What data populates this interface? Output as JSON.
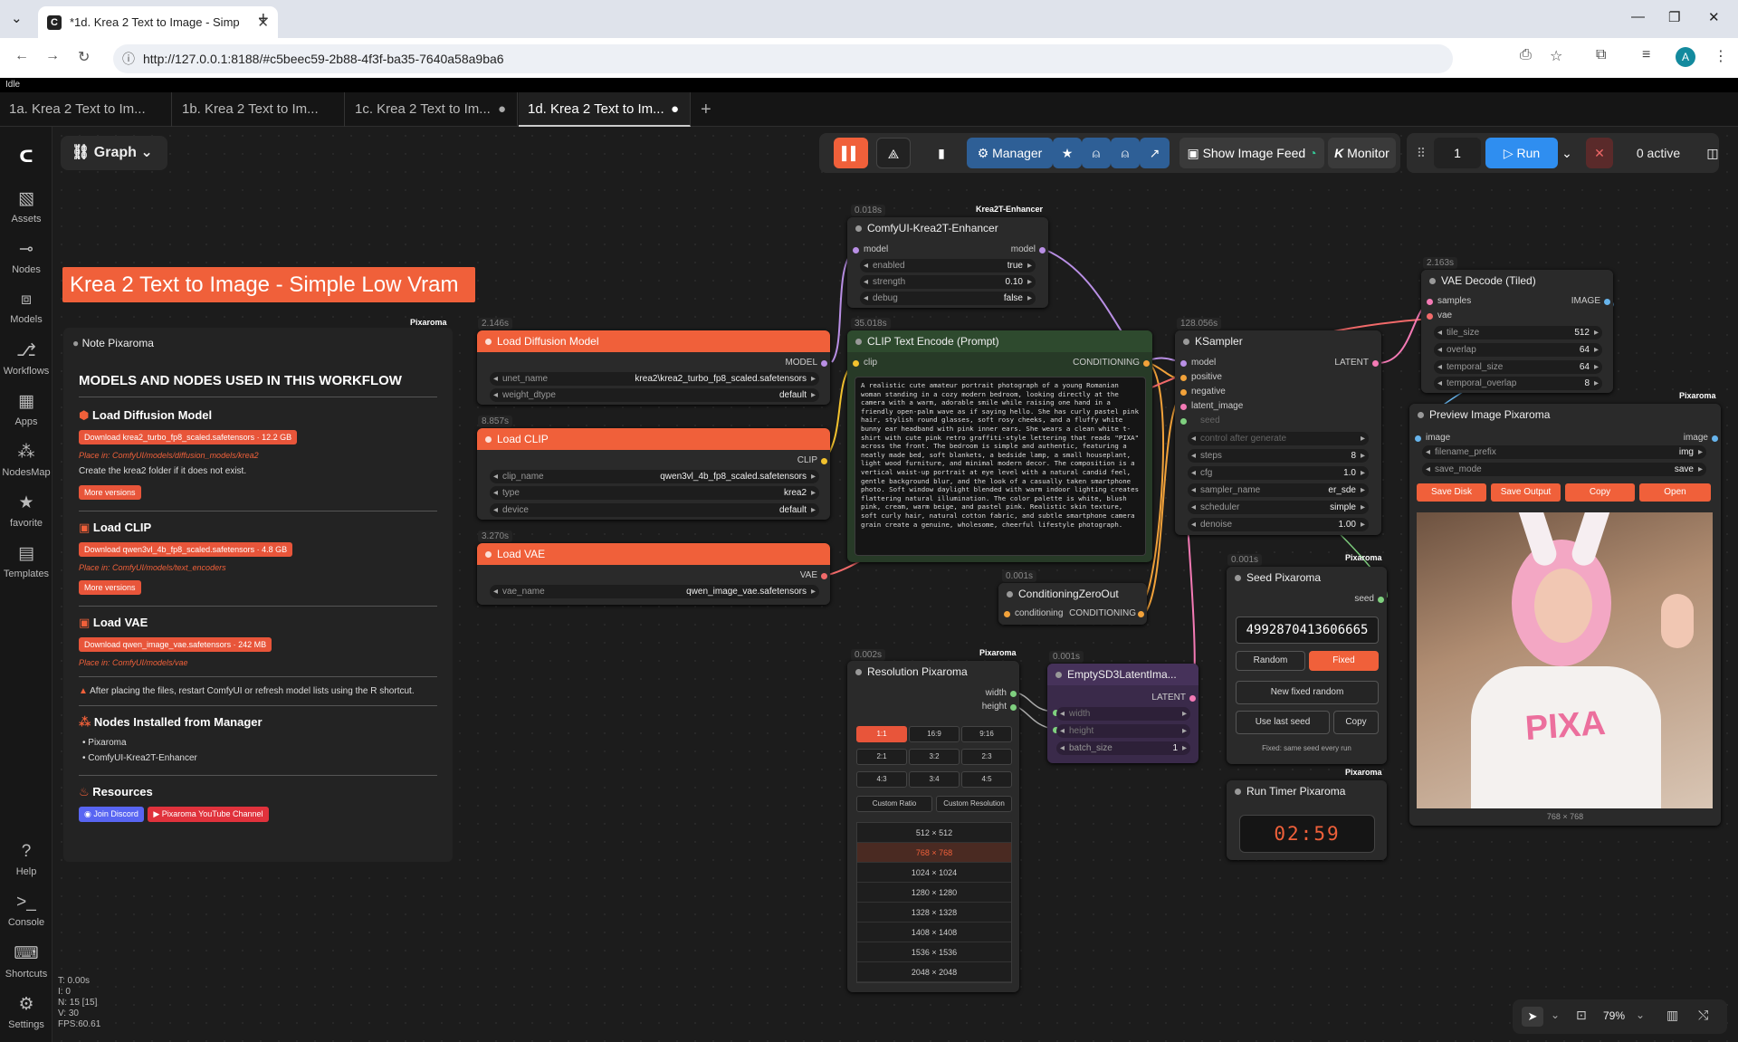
{
  "browser": {
    "tab_title": "*1d. Krea 2 Text to Image - Simp",
    "url": "http://127.0.0.1:8188/#c5beec59-2b88-4f3f-ba35-7640a58a9ba6",
    "avatar": "A"
  },
  "status": "Idle",
  "workflow_tabs": [
    {
      "label": "1a. Krea 2 Text to Im..."
    },
    {
      "label": "1b. Krea 2 Text to Im..."
    },
    {
      "label": "1c. Krea 2 Text to Im..."
    },
    {
      "label": "1d. Krea 2 Text to Im..."
    }
  ],
  "sidebar": {
    "items": [
      {
        "label": "Assets",
        "icon": "image-icon"
      },
      {
        "label": "Nodes",
        "icon": "plug-icon"
      },
      {
        "label": "Models",
        "icon": "cube-icon"
      },
      {
        "label": "Workflows",
        "icon": "flow-icon"
      },
      {
        "label": "Apps",
        "icon": "grid-icon"
      },
      {
        "label": "NodesMap",
        "icon": "map-icon"
      },
      {
        "label": "favorite",
        "icon": "star-icon"
      },
      {
        "label": "Templates",
        "icon": "template-icon"
      },
      {
        "label": "Help",
        "icon": "help-icon"
      },
      {
        "label": "Console",
        "icon": "terminal-icon"
      },
      {
        "label": "Shortcuts",
        "icon": "keyboard-icon"
      },
      {
        "label": "Settings",
        "icon": "gear-icon"
      }
    ]
  },
  "toolbar": {
    "graph": "Graph",
    "manager": "Manager",
    "show_feed": "Show Image Feed",
    "monitor": "Monitor",
    "queue_count": "1",
    "run": "Run",
    "active": "0 active"
  },
  "title_banner": "Krea 2 Text to Image - Simple Low Vram",
  "note": {
    "brand": "Pixaroma",
    "title": "Note Pixaroma",
    "heading": "MODELS AND NODES USED IN THIS WORKFLOW",
    "s1_title": "Load Diffusion Model",
    "s1_dl": "Download krea2_turbo_fp8_scaled.safetensors · 12.2 GB",
    "s1_place": "Place in: ComfyUI/models/diffusion_models/krea2",
    "s1_note": "Create the  krea2  folder if it does not exist.",
    "more": "More versions",
    "s2_title": "Load CLIP",
    "s2_dl": "Download qwen3vl_4b_fp8_scaled.safetensors · 4.8 GB",
    "s2_place": "Place in: ComfyUI/models/text_encoders",
    "s3_title": "Load VAE",
    "s3_dl": "Download qwen_image_vae.safetensors · 242 MB",
    "s3_place": "Place in: ComfyUI/models/vae",
    "warning": "After placing the files, restart ComfyUI or refresh model lists using the R shortcut.",
    "s4_title": "Nodes Installed from Manager",
    "s4_items": [
      "Pixaroma",
      "ComfyUI-Krea2T-Enhancer"
    ],
    "s5_title": "Resources",
    "discord": "Join Discord",
    "youtube": "Pixaroma YouTube Channel"
  },
  "nodes": {
    "load_diffusion": {
      "time": "2.146s",
      "title": "Load Diffusion Model",
      "out": "MODEL",
      "unet_name_l": "unet_name",
      "unet_name": "krea2\\krea2_turbo_fp8_scaled.safetensors",
      "weight_l": "weight_dtype",
      "weight": "default"
    },
    "load_clip": {
      "time": "8.857s",
      "title": "Load CLIP",
      "out": "CLIP",
      "clip_name_l": "clip_name",
      "clip_name": "qwen3vl_4b_fp8_scaled.safetensors",
      "type_l": "type",
      "type": "krea2",
      "device_l": "device",
      "device": "default"
    },
    "load_vae": {
      "time": "3.270s",
      "title": "Load VAE",
      "out": "VAE",
      "vae_name_l": "vae_name",
      "vae_name": "qwen_image_vae.safetensors"
    },
    "enhancer": {
      "time": "0.018s",
      "brand": "Krea2T-Enhancer",
      "title": "ComfyUI-Krea2T-Enhancer",
      "in": "model",
      "out": "model",
      "enabled_l": "enabled",
      "enabled": "true",
      "strength_l": "strength",
      "strength": "0.10",
      "debug_l": "debug",
      "debug": "false"
    },
    "clip_encode": {
      "time": "35.018s",
      "title": "CLIP Text Encode (Prompt)",
      "in": "clip",
      "out": "CONDITIONING",
      "prompt": "A realistic cute amateur portrait photograph of a young Romanian woman standing in a cozy modern bedroom, looking directly at the camera with a warm, adorable smile while raising one hand in a friendly open-palm wave as if saying hello. She has curly pastel pink hair, stylish round glasses, soft rosy cheeks, and a fluffy white bunny ear headband with pink inner ears. She wears a clean white t-shirt with cute pink retro graffiti-style lettering that reads \"PIXA\" across the front. The bedroom is simple and authentic, featuring a neatly made bed, soft blankets, a bedside lamp, a small houseplant, light wood furniture, and minimal modern decor. The composition is a vertical waist-up portrait at eye level with a natural candid feel, gentle background blur, and the look of a casually taken smartphone photo. Soft window daylight blended with warm indoor lighting creates flattering natural illumination. The color palette is white, blush pink, cream, warm beige, and pastel pink. Realistic skin texture, soft curly hair, natural cotton fabric, and subtle smartphone camera grain create a genuine, wholesome, cheerful lifestyle photograph."
    },
    "cond_zero": {
      "time": "0.001s",
      "title": "ConditioningZeroOut",
      "in": "conditioning",
      "out": "CONDITIONING"
    },
    "ksampler": {
      "time": "128.056s",
      "title": "KSampler",
      "inputs": [
        "model",
        "positive",
        "negative",
        "latent_image",
        "seed"
      ],
      "out": "LATENT",
      "control": "control after generate",
      "steps_l": "steps",
      "steps": "8",
      "cfg_l": "cfg",
      "cfg": "1.0",
      "sampler_l": "sampler_name",
      "sampler": "er_sde",
      "scheduler_l": "scheduler",
      "scheduler": "simple",
      "denoise_l": "denoise",
      "denoise": "1.00"
    },
    "vae_decode": {
      "time": "2.163s",
      "title": "VAE Decode (Tiled)",
      "in1": "samples",
      "in2": "vae",
      "out": "IMAGE",
      "tile_l": "tile_size",
      "tile": "512",
      "overlap_l": "overlap",
      "overlap": "64",
      "tsize_l": "temporal_size",
      "tsize": "64",
      "tover_l": "temporal_overlap",
      "tover": "8"
    },
    "preview": {
      "brand": "Pixaroma",
      "title": "Preview Image Pixaroma",
      "in": "image",
      "out": "image",
      "prefix_l": "filename_prefix",
      "prefix": "img",
      "save_l": "save_mode",
      "save": "save",
      "b1": "Save Disk",
      "b2": "Save Output",
      "b3": "Copy",
      "b4": "Open",
      "dims": "768 × 768",
      "shirt_text": "PIXA"
    },
    "resolution": {
      "time": "0.002s",
      "brand": "Pixaroma",
      "title": "Resolution Pixaroma",
      "out1": "width",
      "out2": "height",
      "ratios": [
        "1:1",
        "16:9",
        "9:16",
        "2:1",
        "3:2",
        "2:3",
        "4:3",
        "3:4",
        "4:5"
      ],
      "custom_ratio": "Custom Ratio",
      "custom_res": "Custom Resolution",
      "sizes": [
        "512 × 512",
        "768 × 768",
        "1024 × 1024",
        "1280 × 1280",
        "1328 × 1328",
        "1408 × 1408",
        "1536 × 1536",
        "2048 × 2048"
      ]
    },
    "empty_latent": {
      "time": "0.001s",
      "title": "EmptySD3LatentIma...",
      "out": "LATENT",
      "w_l": "width",
      "h_l": "height",
      "batch_l": "batch_size",
      "batch": "1"
    },
    "seed": {
      "time": "0.001s",
      "brand": "Pixaroma",
      "title": "Seed Pixaroma",
      "out": "seed",
      "value": "4992870413606665",
      "random": "Random",
      "fixed": "Fixed",
      "new_fixed": "New fixed random",
      "use_last": "Use last seed",
      "copy": "Copy",
      "hint": "Fixed: same seed every run"
    },
    "timer": {
      "brand": "Pixaroma",
      "title": "Run Timer Pixaroma",
      "value": "02:59"
    }
  },
  "stats": {
    "t": "T: 0.00s",
    "i": "I: 0",
    "n": "N: 15 [15]",
    "v": "V: 30",
    "fps": "FPS:60.61"
  },
  "zoom": "79%"
}
